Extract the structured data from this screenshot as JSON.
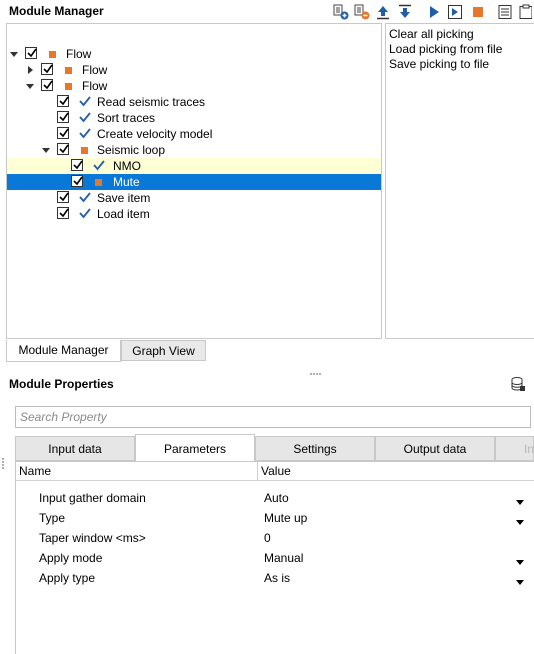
{
  "module_manager": {
    "title": "Module Manager",
    "toolbar_icons": [
      "add-module-icon",
      "remove-module-icon",
      "move-up-icon",
      "move-down-icon",
      "run-icon",
      "run-step-icon",
      "stop-icon",
      "log-icon",
      "clipboard-icon"
    ],
    "tree": [
      {
        "label": "Flow",
        "level": 0,
        "expander": "expanded",
        "checked": true,
        "icon": "flow-square-icon"
      },
      {
        "label": "Flow",
        "level": 1,
        "expander": "collapsed",
        "checked": true,
        "icon": "flow-square-icon"
      },
      {
        "label": "Flow",
        "level": 1,
        "expander": "expanded",
        "checked": true,
        "icon": "flow-square-icon"
      },
      {
        "label": "Read seismic traces",
        "level": 2,
        "expander": "none",
        "checked": true,
        "icon": "module-check-icon"
      },
      {
        "label": "Sort traces",
        "level": 2,
        "expander": "none",
        "checked": true,
        "icon": "module-check-icon"
      },
      {
        "label": "Create velocity model",
        "level": 2,
        "expander": "none",
        "checked": true,
        "icon": "module-check-icon"
      },
      {
        "label": "Seismic loop",
        "level": 2,
        "expander": "expanded",
        "checked": true,
        "icon": "flow-square-icon"
      },
      {
        "label": "NMO",
        "level": 3,
        "expander": "none",
        "checked": true,
        "icon": "module-check-icon",
        "highlight": "yellow"
      },
      {
        "label": "Mute",
        "level": 3,
        "expander": "none",
        "checked": true,
        "icon": "flow-square-icon",
        "highlight": "selected"
      },
      {
        "label": "Save item",
        "level": 2,
        "expander": "none",
        "checked": true,
        "icon": "module-check-icon"
      },
      {
        "label": "Load item",
        "level": 2,
        "expander": "none",
        "checked": true,
        "icon": "module-check-icon"
      }
    ],
    "actions": [
      "Clear all picking",
      "Load picking from file",
      "Save picking to file"
    ],
    "tabs": [
      "Module Manager",
      "Graph View"
    ],
    "active_tab": "Module Manager"
  },
  "module_properties": {
    "title": "Module Properties",
    "search_placeholder": "Search Property",
    "tabs": [
      "Input data",
      "Parameters",
      "Settings",
      "Output data",
      "In"
    ],
    "active_tab": "Parameters",
    "columns": {
      "name": "Name",
      "value": "Value"
    },
    "rows": [
      {
        "name": "Input gather domain",
        "value": "Auto",
        "dropdown": true
      },
      {
        "name": "Type",
        "value": "Mute up",
        "dropdown": true
      },
      {
        "name": "Taper window <ms>",
        "value": "0",
        "dropdown": false
      },
      {
        "name": "Apply mode",
        "value": "Manual",
        "dropdown": true
      },
      {
        "name": "Apply type",
        "value": "As is",
        "dropdown": true
      }
    ]
  },
  "colors": {
    "accent_flow": "#e8762b",
    "check_blue": "#1f5fa8",
    "selection": "#0a78d7",
    "highlight": "#ffffd6"
  }
}
